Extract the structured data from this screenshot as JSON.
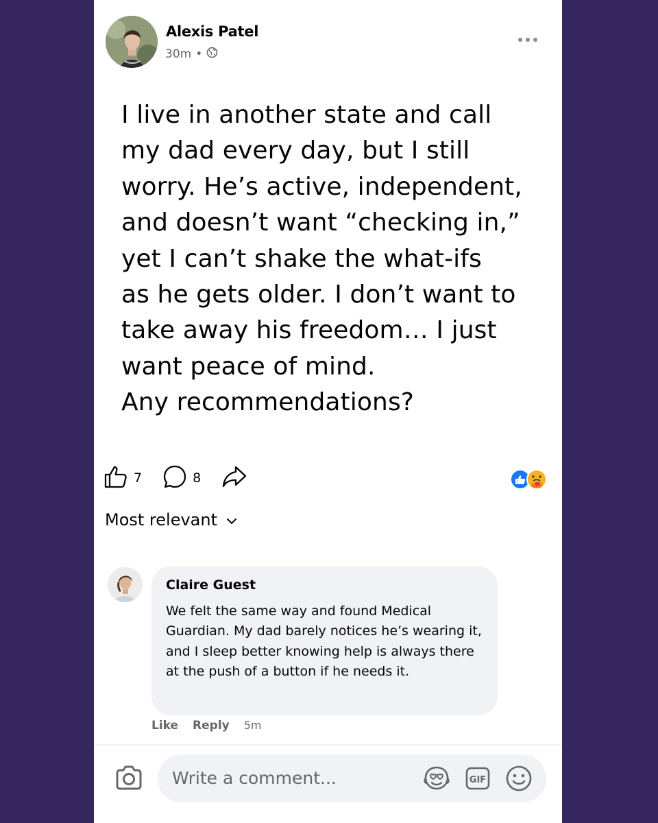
{
  "post": {
    "author": "Alexis Patel",
    "time": "30m",
    "separator": "•",
    "privacy_icon": "globe-icon",
    "more_icon": "more-dots-icon",
    "text": "I live in another state and call\nmy dad every day, but I still\nworry. He’s active, independent,\nand doesn’t want “checking in,”\nyet I can’t shake the what-ifs\nas he gets older. I don’t want to\ntake away his freedom… I just\nwant peace of mind.\nAny recommendations?",
    "likes": "7",
    "comments": "8",
    "reaction_icons": [
      "like-reaction-icon",
      "care-reaction-icon"
    ]
  },
  "comments_header": {
    "sort_label": "Most relevant"
  },
  "comment": {
    "author": "Claire Guest",
    "text": "We felt the same way and found Medical Guardian. My dad barely notices he’s wearing it, and I sleep better knowing help is always there at the push of a button if he needs it.",
    "like_label": "Like",
    "reply_label": "Reply",
    "time": "5m"
  },
  "composer": {
    "placeholder": "Write a comment...",
    "icons": [
      "camera-icon",
      "avatar-sticker-icon",
      "gif-icon",
      "emoji-icon"
    ]
  },
  "colors": {
    "page_background": "#35265f",
    "card": "#ffffff",
    "bubble": "#f0f2f5",
    "secondary_text": "#65676b",
    "like_blue": "#1877f2"
  }
}
